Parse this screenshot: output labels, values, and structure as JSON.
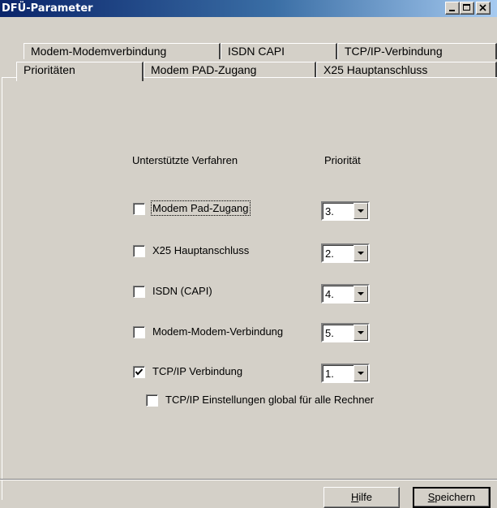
{
  "window": {
    "title": "DFÜ-Parameter",
    "buttons": [
      "minimize",
      "maximize",
      "close"
    ]
  },
  "tabs": {
    "row1": [
      {
        "label": "Modem-Modemverbindung"
      },
      {
        "label": "ISDN CAPI"
      },
      {
        "label": "TCP/IP-Verbindung"
      }
    ],
    "row2": [
      {
        "label": "Prioritäten",
        "selected": true
      },
      {
        "label": "Modem PAD-Zugang"
      },
      {
        "label": "X25  Hauptanschluss"
      }
    ]
  },
  "panel": {
    "col_procedures": "Unterstützte Verfahren",
    "col_priority": "Priorität",
    "rows": [
      {
        "label": "Modem Pad-Zugang",
        "checked": false,
        "priority": "3.",
        "focused": true
      },
      {
        "label": "X25 Hauptanschluss",
        "checked": false,
        "priority": "2."
      },
      {
        "label": "ISDN (CAPI)",
        "checked": false,
        "priority": "4."
      },
      {
        "label": "Modem-Modem-Verbindung",
        "checked": false,
        "priority": "5."
      },
      {
        "label": "TCP/IP Verbindung",
        "checked": true,
        "priority": "1."
      }
    ],
    "global_option": {
      "label": "TCP/IP Einstellungen global für alle Rechner",
      "checked": false
    }
  },
  "footer": {
    "help": {
      "accel": "H",
      "rest": "ilfe"
    },
    "save": {
      "accel": "S",
      "rest": "peichern"
    }
  }
}
